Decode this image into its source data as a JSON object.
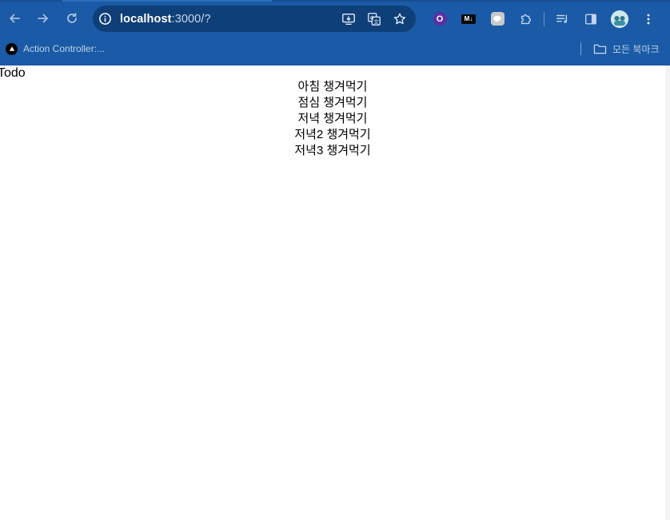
{
  "browser": {
    "url_host": "localhost",
    "url_path": ":3000/?",
    "nav": {
      "back_icon": "arrow-left-icon",
      "forward_icon": "arrow-right-icon",
      "reload_icon": "reload-icon"
    },
    "omnibox_icons": [
      "install-app-icon",
      "translate-icon",
      "star-icon"
    ],
    "extensions": {
      "ext1_letter": "O",
      "ext2_label": "M↓"
    },
    "accent": "#1a5aa6"
  },
  "bookmarks": {
    "items": [
      {
        "label": "Action Controller:..."
      }
    ],
    "all_bookmarks_label": "모든 북마크"
  },
  "page": {
    "title": "Todo",
    "todos": [
      "아침 챙겨먹기",
      "점심 챙겨먹기",
      "저녁 챙겨먹기",
      "저녁2 챙겨먹기",
      "저녁3 챙겨먹기"
    ]
  }
}
